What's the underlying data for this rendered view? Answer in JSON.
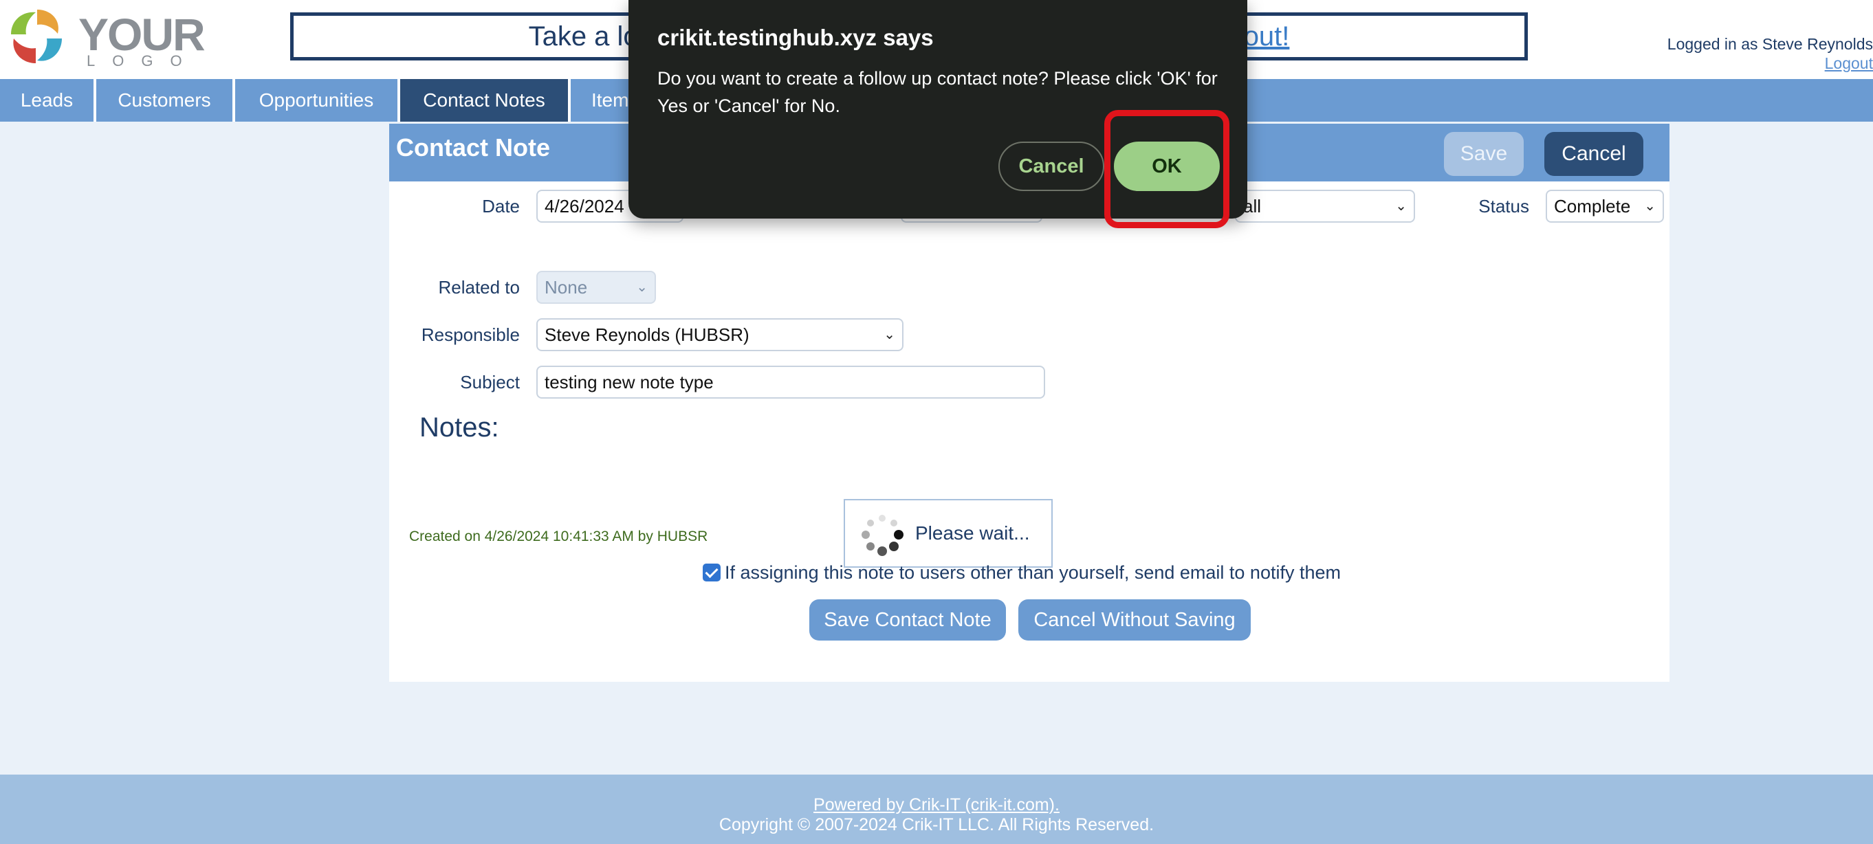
{
  "header": {
    "logo_main": "YOUR",
    "logo_sub": "LOGO",
    "banner_prefix": "Take a lo",
    "banner_link": "out!",
    "logged_in_text": "Logged in as Steve Reynolds",
    "logout_label": "Logout"
  },
  "nav": {
    "tabs": [
      {
        "label": "Leads"
      },
      {
        "label": "Customers"
      },
      {
        "label": "Opportunities"
      },
      {
        "label": "Contact Notes"
      },
      {
        "label": "Item"
      }
    ]
  },
  "panel": {
    "title": "Contact Note",
    "save_label": "Save",
    "cancel_label": "Cancel",
    "date_label": "Date",
    "date_value": "4/26/2024",
    "type_value": "all",
    "status_label": "Status",
    "status_value": "Complete",
    "related_label": "Related to",
    "related_value": "None",
    "responsible_label": "Responsible",
    "responsible_value": "Steve Reynolds (HUBSR)",
    "subject_label": "Subject",
    "subject_value": "testing new note type",
    "notes_label": "Notes:",
    "created_text": "Created on 4/26/2024 10:41:33 AM by HUBSR",
    "wait_text": "Please wait...",
    "notify_text": "If assigning this note to users other than yourself, send email to notify them",
    "save_contact_note_label": "Save Contact Note",
    "cancel_without_saving_label": "Cancel Without Saving"
  },
  "footer": {
    "powered_text": "Powered by Crik-IT (crik-it.com).",
    "copyright_text": "Copyright © 2007-2024 Crik-IT LLC. All Rights Reserved."
  },
  "dialog": {
    "title": "crikit.testinghub.xyz says",
    "message": "Do you want to create a follow up contact note? Please click 'OK' for Yes or 'Cancel' for No.",
    "cancel_label": "Cancel",
    "ok_label": "OK"
  },
  "colors": {
    "nav_blue": "#6b9bd2",
    "nav_active": "#2c4e77",
    "dialog_bg": "#1f221f",
    "ok_green": "#9ccf87",
    "highlight_red": "#e0141b"
  }
}
